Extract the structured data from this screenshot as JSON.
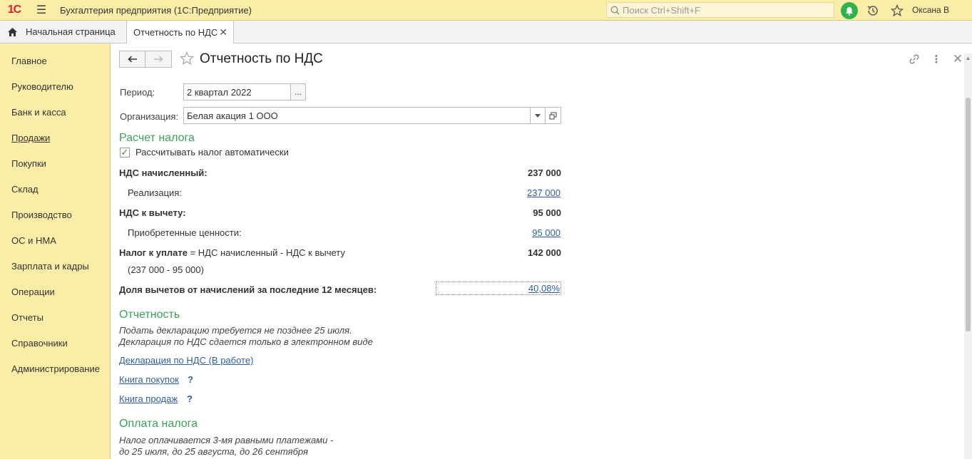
{
  "app": {
    "logo_text": "1С",
    "title": "Бухгалтерия предприятия  (1С:Предприятие)",
    "search_placeholder": "Поиск Ctrl+Shift+F",
    "user": "Оксана В",
    "accent_color": "#fbeda8"
  },
  "tabs": {
    "home": "Начальная страница",
    "active": "Отчетность по НДС"
  },
  "sidebar": {
    "items": [
      {
        "label": "Главное"
      },
      {
        "label": "Руководителю"
      },
      {
        "label": "Банк и касса"
      },
      {
        "label": "Продажи"
      },
      {
        "label": "Покупки"
      },
      {
        "label": "Склад"
      },
      {
        "label": "Производство"
      },
      {
        "label": "ОС и НМА"
      },
      {
        "label": "Зарплата и кадры"
      },
      {
        "label": "Операции"
      },
      {
        "label": "Отчеты"
      },
      {
        "label": "Справочники"
      },
      {
        "label": "Администрирование"
      }
    ]
  },
  "form": {
    "title": "Отчетность по НДС",
    "period_label": "Период:",
    "period_value": "2 квартал 2022",
    "period_btn": "...",
    "org_label": "Организация:",
    "org_value": "Белая акация 1 ООО",
    "tax_section": "Расчет налога",
    "auto_calc_label": "Рассчитывать налог автоматически",
    "auto_calc_checked": true,
    "vat_accrued_label": "НДС начисленный:",
    "vat_accrued_value": "237 000",
    "sales_label": "Реализация:",
    "sales_value": "237 000",
    "vat_deduct_label": "НДС к вычету:",
    "vat_deduct_value": "95 000",
    "purchased_label": "Приобретенные ценности:",
    "purchased_value": "95 000",
    "tax_payable_bold": "Налог к уплате",
    "tax_payable_formula": " = НДС начисленный - НДС к вычету",
    "tax_payable_value": "142 000",
    "tax_payable_calc": "(237 000 - 95 000)",
    "share_label": "Доля вычетов от начислений за последние 12 месяцев:",
    "share_value": "40,08%",
    "reporting_section": "Отчетность",
    "reporting_note1": "Подать декларацию требуется не позднее 25 июля.",
    "reporting_note2": "Декларация по НДС сдается только в электронном виде",
    "declaration_link": "Декларация по НДС (В работе)",
    "purchase_book_link": "Книга покупок",
    "sales_book_link": "Книга продаж",
    "help_mark": "?",
    "payment_section": "Оплата налога",
    "payment_note1": "Налог оплачивается 3-мя равными платежами -",
    "payment_note2": "до 25 июля, до 25 августа, до 26 сентября"
  }
}
